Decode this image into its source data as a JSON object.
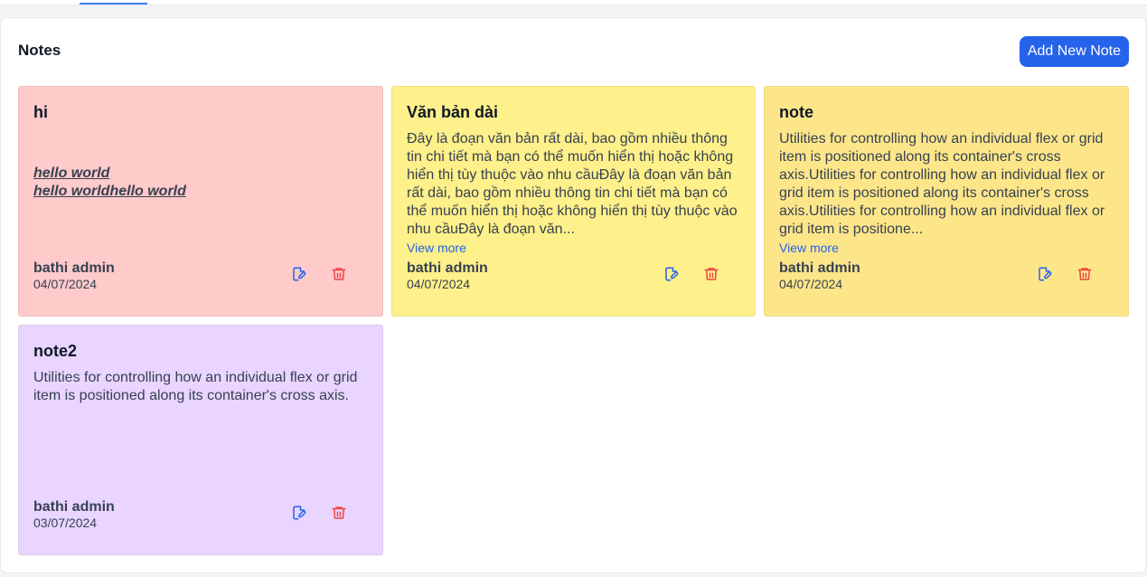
{
  "header": {
    "title": "Notes",
    "add_label": "Add New Note"
  },
  "colors": {
    "primary": "#2563eb",
    "edit_icon": "#2563eb",
    "delete_icon": "#ef4444"
  },
  "notes": [
    {
      "title": "hi",
      "rich_lines": [
        "hello world",
        "hello worldhello world"
      ],
      "author": "bathi admin",
      "date": "04/07/2024",
      "bg": "#fecaca"
    },
    {
      "title": "Văn bản dài",
      "body": "Đây là đoạn văn bản rất dài, bao gồm nhiều thông tin chi tiết mà bạn có thể muốn hiển thị hoặc không hiển thị tùy thuộc vào nhu cầuĐây là đoạn văn bản rất dài, bao gồm nhiều thông tin chi tiết mà bạn có thể muốn hiển thị hoặc không hiển thị tùy thuộc vào nhu cầuĐây là đoạn văn...",
      "view_more": "View more",
      "author": "bathi admin",
      "date": "04/07/2024",
      "bg": "#fef08a"
    },
    {
      "title": "note",
      "body": "Utilities for controlling how an individual flex or grid item is positioned along its container's cross axis.Utilities for controlling how an individual flex or grid item is positioned along its container's cross axis.Utilities for controlling how an individual flex or grid item is positione...",
      "view_more": "View more",
      "author": "bathi admin",
      "date": "04/07/2024",
      "bg": "#fde68a"
    },
    {
      "title": "note2",
      "body": "Utilities for controlling how an individual flex or grid item is positioned along its container's cross axis.",
      "author": "bathi admin",
      "date": "03/07/2024",
      "bg": "#e9d5ff"
    }
  ]
}
